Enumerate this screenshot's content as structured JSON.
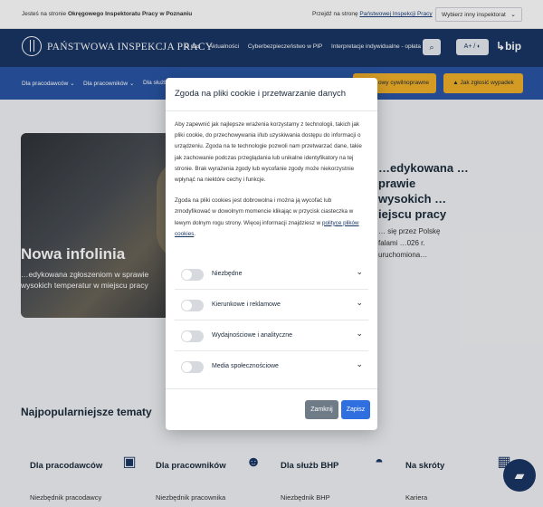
{
  "topbar": {
    "context_prefix": "Jesteś na stronie ",
    "context_name": "Okręgowego Inspektoratu Pracy w Poznaniu",
    "switch_prefix": "Przejdź na stronę ",
    "switch_link": "Państwowej Inspekcji Pracy",
    "inspectorate_select": "Wybierz inny inspektorat"
  },
  "header": {
    "logo_text": "PAŃSTWOWA INSPEKCJA PRACY",
    "nav": [
      "O nas",
      "Aktualności",
      "Cyberbezpieczeństwo w PIP",
      "Interpretacje indywidualne - opłata"
    ],
    "a11y_label": "A+ / ◐",
    "bip_label": "bip"
  },
  "subnav": {
    "items": [
      "Dla pracodawców",
      "Dla pracowników",
      "Dla służb"
    ],
    "cta_1": "…owy cywilnoprawne",
    "cta_2": "Jak zgłosić wypadek"
  },
  "hero": {
    "title": "Nowa infolinia",
    "subtitle": "…edykowana zgłoszeniom w sprawie wysokich temperatur w miejscu pracy"
  },
  "article": {
    "title": "…edykowana …prawie wysokich …iejscu pracy",
    "text": "… się przez Polskę falami …026 r. uruchomiona…"
  },
  "popular": {
    "title": "Najpopularniejsze tematy",
    "topics": [
      {
        "label": "Dla pracodawców",
        "link": "Niezbędnik pracodawcy",
        "icon": "briefcase-icon"
      },
      {
        "label": "Dla pracowników",
        "link": "Niezbędnik pracownika",
        "icon": "worker-icon"
      },
      {
        "label": "Dla służb BHP",
        "link": "Niezbędnik BHP",
        "icon": "helmet-icon"
      },
      {
        "label": "Na skróty",
        "link": "Kariera",
        "icon": "shortcut-icon"
      }
    ]
  },
  "modal": {
    "title": "Zgoda na pliki cookie i przetwarzanie danych",
    "para1": "Aby zapewnić jak najlepsze wrażenia korzystamy z technologii, takich jak pliki cookie, do przechowywania i/lub uzyskiwania dostępu do informacji o urządzeniu. Zgoda na te technologie pozwoli nam przetwarzać dane, takie jak zachowanie podczas przeglądania lub unikalne identyfikatory na tej stronie. Brak wyrażenia zgody lub wycofanie zgody może niekorzystnie wpłynąć na niektóre cechy i funkcje.",
    "para2_text": "Zgoda na pliki cookies jest dobrowolna i można ją wycofać lub zmodyfikować w dowolnym momencie klikając w przycisk ciasteczka w lewym dolnym rogu strony. Więcej informacji znajdziesz w ",
    "para2_link": "polityce plików cookies",
    "para2_end": ".",
    "categories": [
      "Niezbędne",
      "Kierunkowe i reklamowe",
      "Wydajnościowe i analityczne",
      "Media społecznościowe"
    ],
    "reject_label": "Zamknij",
    "save_label": "Zapisz"
  }
}
